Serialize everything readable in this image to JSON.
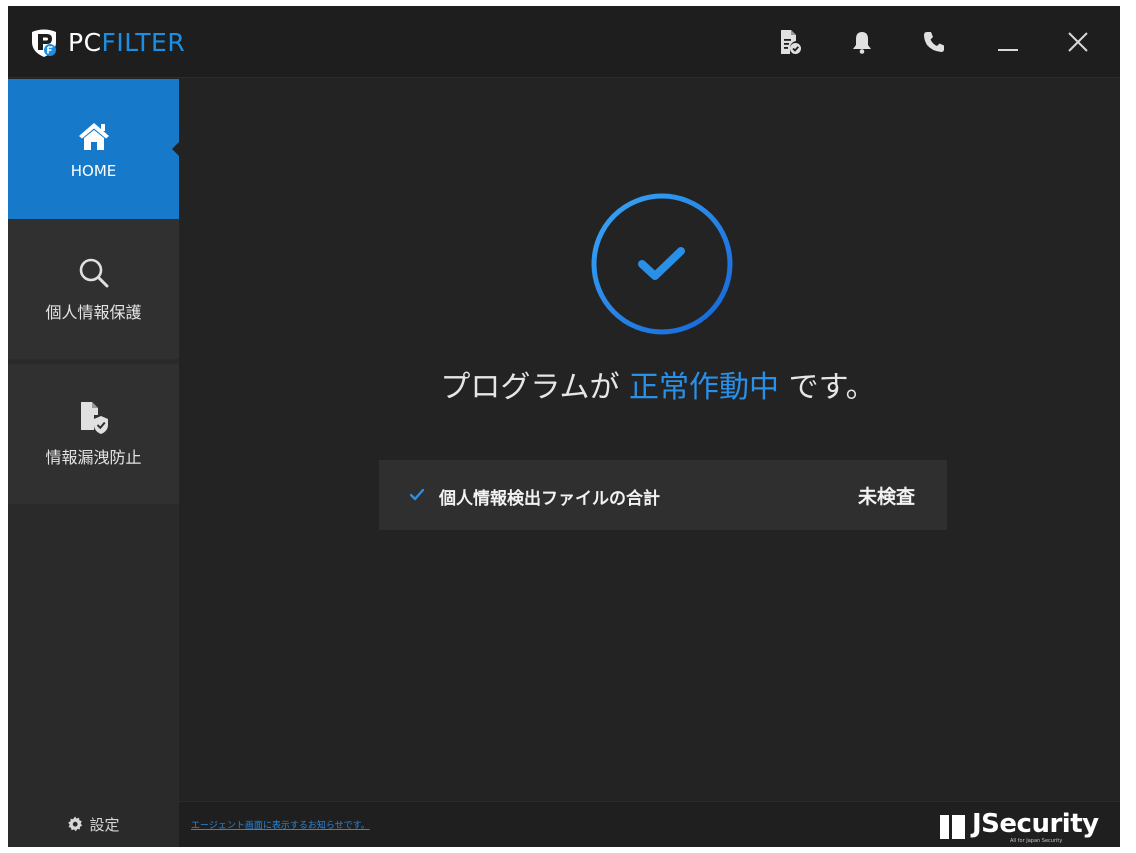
{
  "app": {
    "logo_pc": "PC",
    "logo_filter": "FILTER",
    "accent_color": "#1779c9"
  },
  "titlebar": {
    "buttons": [
      {
        "name": "report-icon"
      },
      {
        "name": "bell-icon"
      },
      {
        "name": "phone-icon"
      },
      {
        "name": "minimize-icon"
      },
      {
        "name": "close-icon"
      }
    ]
  },
  "sidebar": {
    "items": [
      {
        "label": "HOME",
        "icon": "home-icon",
        "active": true
      },
      {
        "label": "個人情報保護",
        "icon": "search-icon",
        "active": false
      },
      {
        "label": "情報漏洩防止",
        "icon": "file-shield-icon",
        "active": false
      }
    ],
    "settings_label": "設定"
  },
  "main": {
    "status_prefix": "プログラムが ",
    "status_highlight": "正常作動中",
    "status_suffix": " です。",
    "info_label": "個人情報検出ファイルの合計",
    "info_value": "未検査"
  },
  "footer": {
    "notice_link": "エージェント画面に表示するお知らせです。",
    "brand_name": "JSecurity",
    "brand_tagline": "All for Japan Security"
  }
}
